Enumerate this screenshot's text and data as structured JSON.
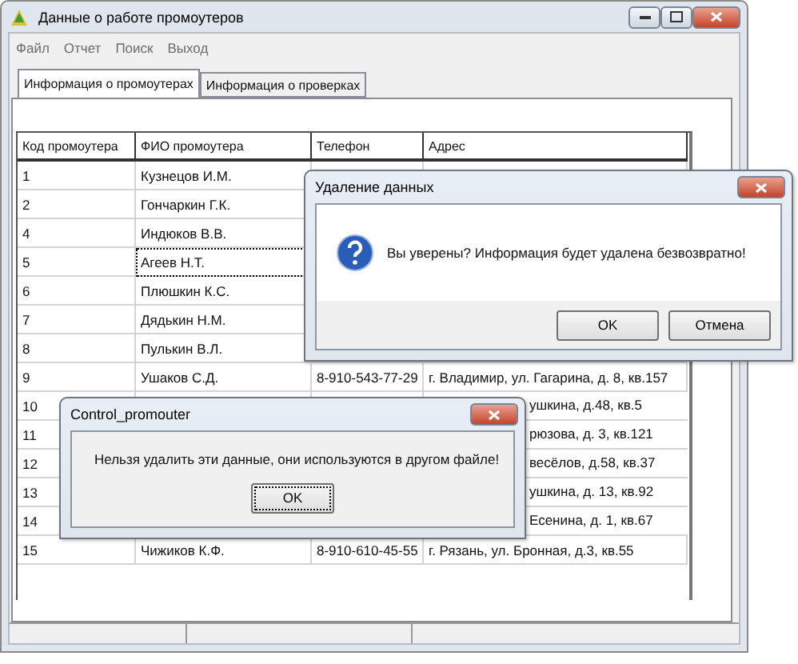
{
  "window": {
    "title": "Данные о работе промоутеров"
  },
  "menu": [
    "Файл",
    "Отчет",
    "Поиск",
    "Выход"
  ],
  "tabs": [
    {
      "label": "Информация о промоутерах",
      "selected": true
    },
    {
      "label": "Информация о проверках",
      "selected": false
    }
  ],
  "table": {
    "columns": [
      "Код промоутера",
      "ФИО промоутера",
      "Телефон",
      "Адрес"
    ],
    "rows": [
      {
        "kind": "right-covered",
        "code": "1",
        "name": "Кузнецов И.М.",
        "focused": false
      },
      {
        "kind": "right-covered",
        "code": "2",
        "name": "Гончаркин Г.К.",
        "focused": false
      },
      {
        "kind": "right-covered",
        "code": "4",
        "name": "Индюков В.В.",
        "focused": false
      },
      {
        "kind": "right-covered",
        "code": "5",
        "name": "Агеев Н.Т.",
        "focused": true
      },
      {
        "kind": "right-covered",
        "code": "6",
        "name": "Плюшкин К.С.",
        "focused": false
      },
      {
        "kind": "right-covered",
        "code": "7",
        "name": "Дядькин Н.М.",
        "focused": false
      },
      {
        "kind": "right-covered",
        "code": "8",
        "name": "Пулькин В.Л.",
        "focused": false
      },
      {
        "kind": "full",
        "code": "9",
        "name": "Ушаков С.Д.",
        "phone": "8-910-543-77-29",
        "address": "г. Владимир, ул. Гагарина, д. 8, кв.157",
        "focused": false
      },
      {
        "kind": "middle-covered",
        "code": "10",
        "address": "ушкина, д.48, кв.5",
        "focused": false
      },
      {
        "kind": "middle-covered",
        "code": "11",
        "address": "рюзова, д. 3, кв.121",
        "focused": false
      },
      {
        "kind": "middle-covered",
        "code": "12",
        "address": "весёлов, д.58, кв.37",
        "focused": false
      },
      {
        "kind": "middle-covered",
        "code": "13",
        "address": "ушкина, д. 13, кв.92",
        "focused": false
      },
      {
        "kind": "middle-covered",
        "code": "14",
        "address": "Есенина, д. 1, кв.67",
        "focused": false
      },
      {
        "kind": "full",
        "code": "15",
        "name": "Чижиков К.Ф.",
        "phone": "8-910-610-45-55",
        "address": "г. Рязань, ул. Бронная, д.3, кв.55",
        "focused": false
      }
    ]
  },
  "dialogs": [
    {
      "kind": "confirm",
      "title": "Удаление данных",
      "message": "Вы уверены? Информация будет удалена безвозвратно!",
      "buttons": [
        {
          "label": "OK",
          "focused": false
        },
        {
          "label": "Отмена",
          "focused": false
        }
      ]
    },
    {
      "kind": "alert",
      "title": "Control_promouter",
      "message": "Нельзя удалить эти данные, они используются в другом файле!",
      "buttons": [
        {
          "label": "OK",
          "focused": true
        }
      ]
    }
  ]
}
